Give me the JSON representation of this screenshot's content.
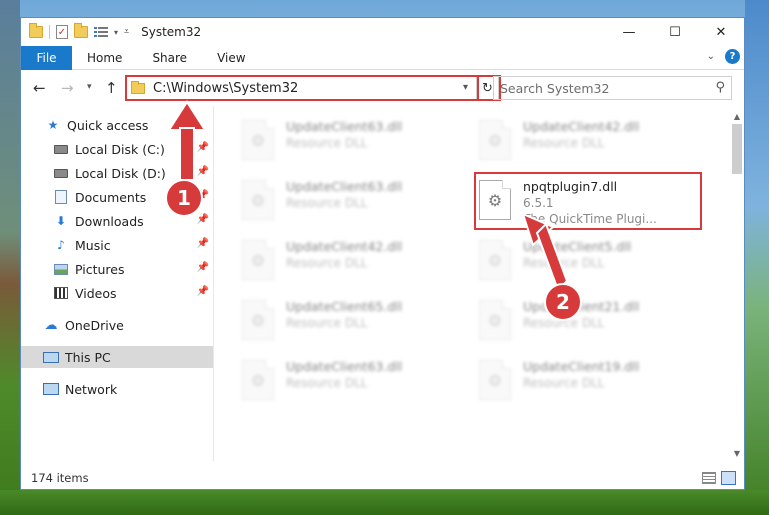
{
  "window": {
    "title": "System32",
    "controls": {
      "minimize": "—",
      "maximize": "☐",
      "close": "✕"
    }
  },
  "ribbon": {
    "tabs": [
      "File",
      "Home",
      "Share",
      "View"
    ],
    "help": "?"
  },
  "nav": {
    "address": "C:\\Windows\\System32",
    "search_placeholder": "Search System32"
  },
  "sidebar": {
    "items": [
      {
        "label": "Quick access",
        "icon": "star-icon",
        "pinned": false
      },
      {
        "label": "Local Disk (C:)",
        "icon": "disk-icon",
        "pinned": true
      },
      {
        "label": "Local Disk (D:)",
        "icon": "disk-icon",
        "pinned": true
      },
      {
        "label": "Documents",
        "icon": "document-icon",
        "pinned": true
      },
      {
        "label": "Downloads",
        "icon": "download-icon",
        "pinned": true
      },
      {
        "label": "Music",
        "icon": "music-icon",
        "pinned": true
      },
      {
        "label": "Pictures",
        "icon": "pictures-icon",
        "pinned": true
      },
      {
        "label": "Videos",
        "icon": "video-icon",
        "pinned": true
      },
      {
        "label": "OneDrive",
        "icon": "cloud-icon",
        "pinned": false
      },
      {
        "label": "This PC",
        "icon": "pc-icon",
        "pinned": false,
        "selected": true
      },
      {
        "label": "Network",
        "icon": "network-icon",
        "pinned": false
      }
    ]
  },
  "files": {
    "items": [
      {
        "name": "UpdateClient63.dll",
        "sub": "Resource DLL"
      },
      {
        "name": "UpdateClient42.dll",
        "sub": "Resource DLL"
      },
      {
        "name": "UpdateClient63.dll",
        "sub": "Resource DLL"
      },
      {
        "name": "npqtplugin7.dll",
        "sub": "6.5.1",
        "desc": "The QuickTime Plugi..."
      },
      {
        "name": "UpdateClient42.dll",
        "sub": "Resource DLL"
      },
      {
        "name": "UpdateClient5.dll",
        "sub": "Resource DLL"
      },
      {
        "name": "UpdateClient65.dll",
        "sub": "Resource DLL"
      },
      {
        "name": "UpdateClient21.dll",
        "sub": "Resource DLL"
      },
      {
        "name": "UpdateClient63.dll",
        "sub": "Resource DLL"
      },
      {
        "name": "UpdateClient19.dll",
        "sub": "Resource DLL"
      }
    ]
  },
  "status": {
    "item_count": "174 items"
  },
  "annotations": {
    "badge1": "1",
    "badge2": "2",
    "color": "#d63a3a"
  }
}
